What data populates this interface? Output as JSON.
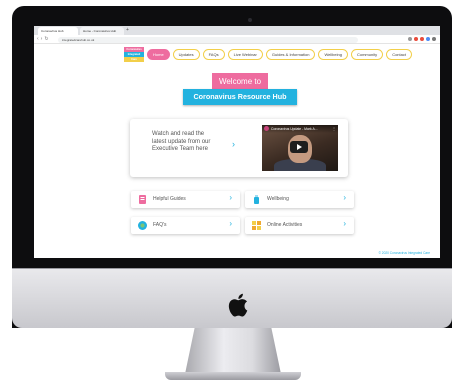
{
  "browser": {
    "tabs": [
      {
        "label": "Coronavirus Hub"
      },
      {
        "label": "Home - Coronavirus Hub"
      }
    ],
    "url": "integratedcarehub.co.uk"
  },
  "site": {
    "logo_lines": [
      "Coronavirus",
      "Integrated",
      "Care"
    ],
    "nav": [
      {
        "label": "Home",
        "active": true
      },
      {
        "label": "Updates"
      },
      {
        "label": "FAQs"
      },
      {
        "label": "Live Webinar"
      },
      {
        "label": "Guides & Information"
      },
      {
        "label": "Wellbeing"
      },
      {
        "label": "Community"
      },
      {
        "label": "Contact"
      }
    ],
    "welcome": "Welcome to",
    "title": "Coronavirus Resource Hub",
    "video_card": {
      "lines": [
        "Watch and read the",
        "latest update from our",
        "Executive Team here"
      ],
      "video_title": "Coronavirus Update - Mark A...",
      "video_more": "⋮"
    },
    "cards": [
      {
        "label": "Helpful Guides"
      },
      {
        "label": "Wellbeing"
      },
      {
        "label": "FAQ's"
      },
      {
        "label": "Online Activities"
      }
    ],
    "chevron": "›",
    "footer": "© 2020 Coronavirus Integrated Care"
  },
  "colors": {
    "pink": "#ee6c9f",
    "blue": "#23b2df",
    "yellow": "#f2cf4a",
    "green": "#7cc576"
  }
}
